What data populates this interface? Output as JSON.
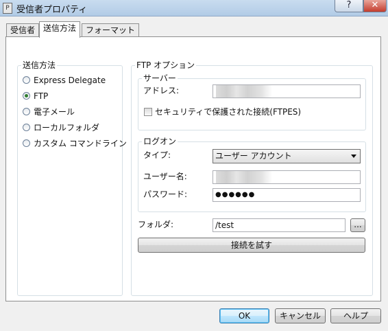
{
  "window": {
    "title": "受信者プロパティ",
    "help_label": "?",
    "close_label": "✕",
    "app_icon_label": "P"
  },
  "tabs": [
    {
      "label": "受信者",
      "active": false
    },
    {
      "label": "送信方法",
      "active": true
    },
    {
      "label": "フォーマット",
      "active": false
    }
  ],
  "send_method": {
    "group_title": "送信方法",
    "options": [
      {
        "label": "Express Delegate",
        "selected": false
      },
      {
        "label": "FTP",
        "selected": true
      },
      {
        "label": "電子メール",
        "selected": false
      },
      {
        "label": "ローカルフォルダ",
        "selected": false
      },
      {
        "label": "カスタム コマンドライン",
        "selected": false
      }
    ]
  },
  "ftp": {
    "group_title": "FTP オプション",
    "server": {
      "group_title": "サーバー",
      "address_label": "アドレス:",
      "address_value": "",
      "ftpes_label": "セキュリティで保護された接続(FTPES)",
      "ftpes_checked": false
    },
    "logon": {
      "group_title": "ログオン",
      "type_label": "タイプ:",
      "type_value": "ユーザー アカウント",
      "username_label": "ユーザー名:",
      "username_value": "",
      "password_label": "パスワード:",
      "password_value": "●●●●●●"
    },
    "folder_label": "フォルダ:",
    "folder_value": "/test",
    "browse_label": "...",
    "test_button_label": "接続を試す"
  },
  "footer": {
    "ok_label": "OK",
    "cancel_label": "キャンセル",
    "help_label": "ヘルプ"
  }
}
